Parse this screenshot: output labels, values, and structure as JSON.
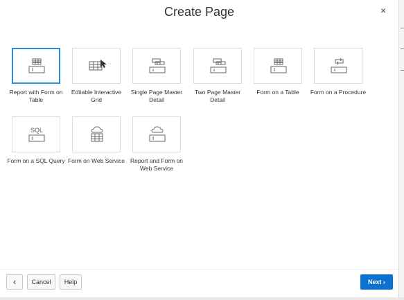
{
  "dialog": {
    "title": "Create Page",
    "close_glyph": "×"
  },
  "tiles": [
    {
      "label": "Report with Form on Table",
      "icon": "report-form-icon",
      "selected": true
    },
    {
      "label": "Editable Interactive Grid",
      "icon": "interactive-grid-icon"
    },
    {
      "label": "Single Page Master Detail",
      "icon": "single-master-detail-icon"
    },
    {
      "label": "Two Page Master Detail",
      "icon": "two-page-master-detail-icon"
    },
    {
      "label": "Form on a Table",
      "icon": "form-table-icon"
    },
    {
      "label": "Form on a Procedure",
      "icon": "form-procedure-icon"
    },
    {
      "label": "Form on a SQL Query",
      "icon": "form-sql-icon",
      "icon_text": "SQL"
    },
    {
      "label": "Form on Web Service",
      "icon": "form-web-service-icon"
    },
    {
      "label": "Report and Form on Web Service",
      "icon": "report-form-web-service-icon"
    }
  ],
  "footer": {
    "back_glyph": "‹",
    "cancel_label": "Cancel",
    "help_label": "Help",
    "next_label": "Next ›"
  },
  "colors": {
    "accent": "#0d72cf",
    "selected_border": "#2a8fd6",
    "icon": "#666666"
  }
}
